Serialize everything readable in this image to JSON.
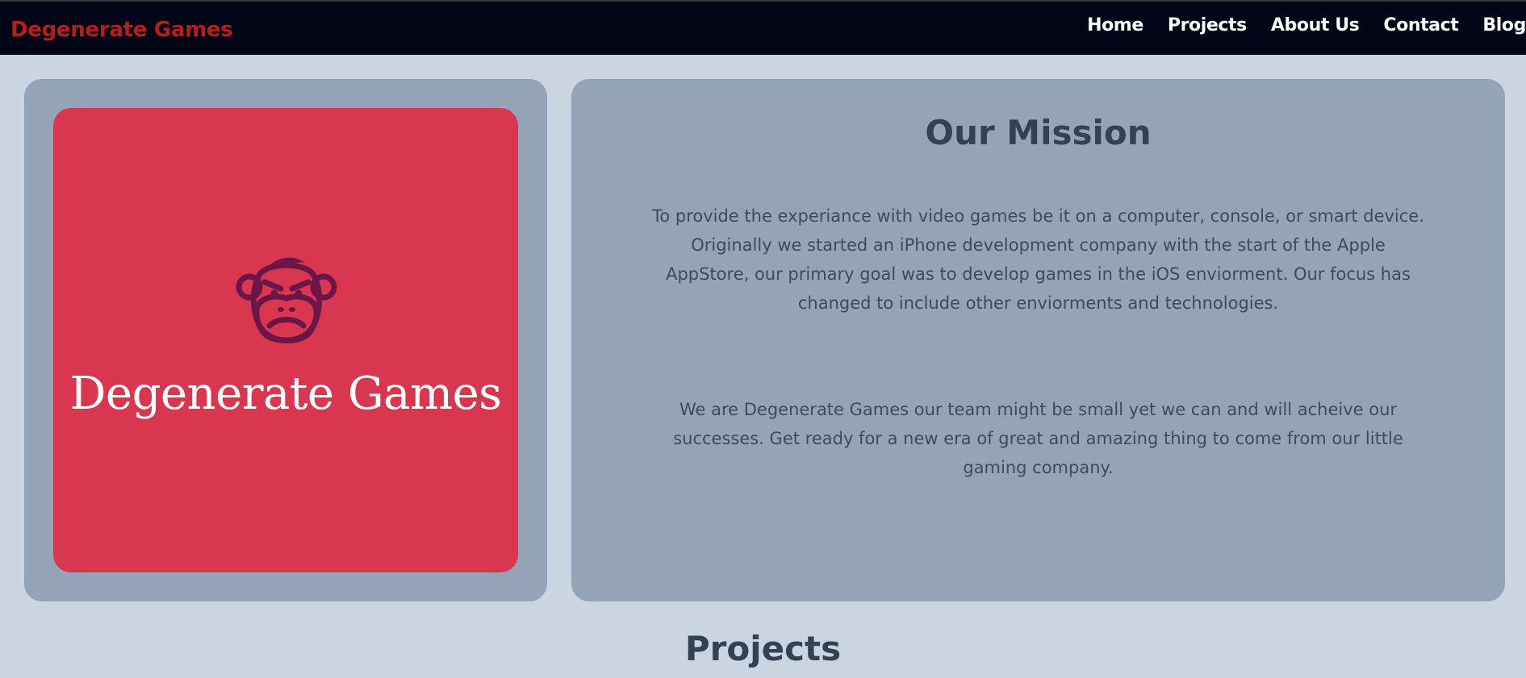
{
  "header": {
    "brand": "Degenerate Games",
    "nav": [
      "Home",
      "Projects",
      "About Us",
      "Contact",
      "Blog"
    ]
  },
  "logo": {
    "icon": "monkey-face-icon",
    "text": "Degenerate Games"
  },
  "mission": {
    "title": "Our Mission",
    "paragraph1_lines": [
      "To provide the experiance with video games be it on a computer, console, or smart device.",
      "Originally we started an iPhone development company with the start of the Apple",
      "AppStore, our primary goal was to develop games in the iOS enviorment. Our focus has",
      "changed to include other enviorments and technologies."
    ],
    "paragraph2_lines": [
      "We are Degenerate Games our team might be small yet we can and will acheive our",
      "successes. Get ready for a new era of great and amazing thing to come from our little",
      "gaming company."
    ]
  },
  "projects": {
    "title": "Projects"
  },
  "colors": {
    "page_bg": "#cbd5e1",
    "nav_bg": "#020617",
    "brand": "#b91c1c",
    "card_bg": "#94a3b8",
    "logo_tile": "#d9374f",
    "logo_icon": "#6b1548",
    "heading": "#334155"
  }
}
